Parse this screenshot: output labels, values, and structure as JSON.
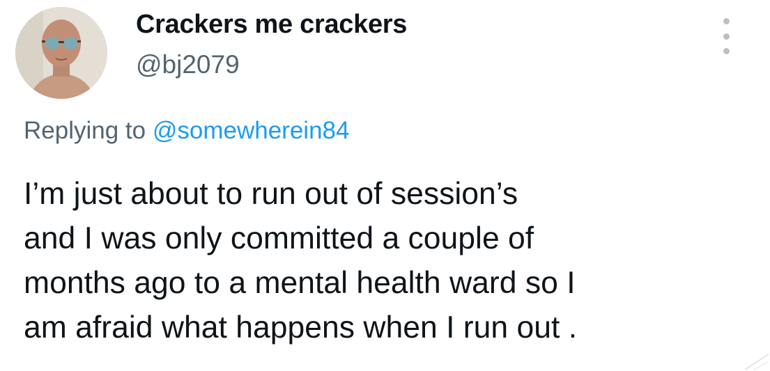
{
  "author": {
    "display_name": "Crackers me crackers",
    "handle": "@bj2079",
    "avatar_icon": "user-avatar-photo"
  },
  "more_icon": "more-vertical-icon",
  "reply": {
    "prefix": "Replying to",
    "mention": "@somewherein84"
  },
  "tweet": {
    "lines": [
      "I’m just about to run out of session’s",
      "and I was only committed a couple of",
      "months ago to a mental health ward so I",
      "am afraid what happens when I run out ."
    ]
  },
  "colors": {
    "text": "#0f1419",
    "secondary": "#536471",
    "link": "#1d9bf0"
  }
}
